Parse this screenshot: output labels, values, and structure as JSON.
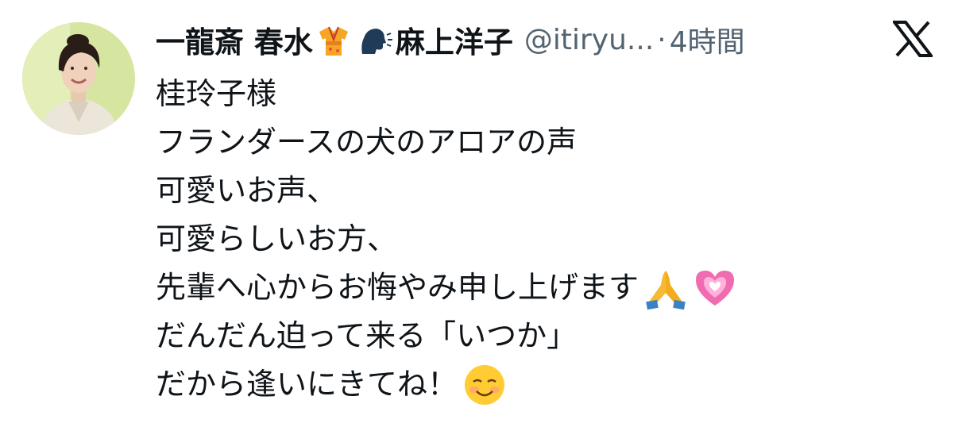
{
  "tweet": {
    "display_name_part1": "一龍斎 春水",
    "display_name_part2": "麻上洋子",
    "handle": "@itiryu...",
    "separator": "·",
    "timestamp": "4時間",
    "emojis": {
      "after_name": "kimono-emoji",
      "speaking": "speaking-head-emoji",
      "pray": "folded-hands-emoji",
      "heart": "growing-heart-emoji",
      "smile": "smiling-face-emoji"
    },
    "lines": [
      "桂玲子様",
      "フランダースの犬のアロアの声",
      "可愛いお声、",
      "可愛らしいお方、",
      "先輩へ心からお悔やみ申し上げます",
      "だんだん迫って来る「いつか」",
      "だから逢いにきてね！"
    ]
  },
  "colors": {
    "text": "#0f1419",
    "secondary": "#536471",
    "background": "#ffffff"
  },
  "icons": {
    "brand": "x-logo-icon"
  }
}
